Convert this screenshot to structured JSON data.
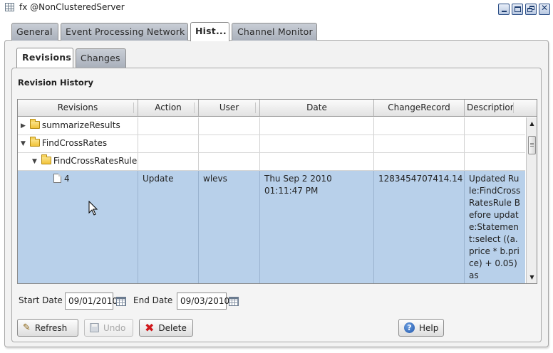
{
  "window": {
    "title": "fx @NonClusteredServer",
    "controls": [
      "minimize",
      "maximize",
      "restore",
      "close"
    ]
  },
  "main_tabs": [
    {
      "label": "General",
      "active": false
    },
    {
      "label": "Event Processing Network",
      "active": false
    },
    {
      "label": "Hist...",
      "active": true
    },
    {
      "label": "Channel Monitor",
      "active": false
    }
  ],
  "sub_tabs": [
    {
      "label": "Revisions",
      "active": true
    },
    {
      "label": "Changes",
      "active": false
    }
  ],
  "section_title": "Revision History",
  "table": {
    "columns": [
      "Revisions",
      "Action",
      "User",
      "Date",
      "ChangeRecord",
      "Descriptior"
    ],
    "rows": [
      {
        "tree": "summarizeResults",
        "expander": "▶",
        "icon": "folder-icon"
      },
      {
        "tree": "FindCrossRates",
        "expander": "▼",
        "icon": "folder-open-icon"
      },
      {
        "tree": "FindCrossRatesRule",
        "expander": "▼",
        "icon": "folder-open-icon"
      },
      {
        "tree": "4",
        "icon": "document-icon",
        "action": "Update",
        "user": "wlevs",
        "date": "Thu Sep 2 2010 01:11:47 PM",
        "change_record": "1283454707414.14",
        "description": "Updated Rule:FindCrossRatesRule Before update:Statement:select ((a.price * b.price) + 0.05) as"
      }
    ]
  },
  "filters": {
    "start_label": "Start Date",
    "start_value": "09/01/2010",
    "end_label": "End Date",
    "end_value": "09/03/2010"
  },
  "buttons": {
    "refresh": "Refresh",
    "undo": "Undo",
    "delete": "Delete",
    "help": "Help"
  },
  "colors": {
    "selected_row": "#b8d0ea",
    "tab_inactive": "#a9b0bb",
    "delete_icon": "#d0171b",
    "help_icon": "#1f56ad"
  }
}
